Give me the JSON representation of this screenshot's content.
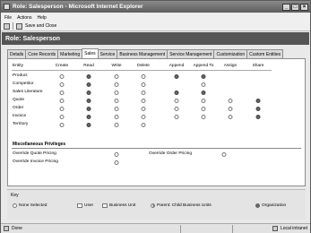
{
  "window": {
    "title": "Role: Salesperson - Microsoft Internet Explorer"
  },
  "menu": [
    "File",
    "Actions",
    "Help"
  ],
  "toolbar": {
    "save_close": "Save and Close"
  },
  "role_header": "Role: Salesperson",
  "tabs": [
    "Details",
    "Core Records",
    "Marketing",
    "Sales",
    "Service",
    "Business Management",
    "Service Management",
    "Customization",
    "Custom Entities"
  ],
  "active_tab": "Sales",
  "grid": {
    "entity_header": "Entity",
    "columns": [
      "Create",
      "Read",
      "Write",
      "Delete",
      "Append",
      "Append To",
      "Assign",
      "Share"
    ],
    "rows": [
      {
        "name": "Product",
        "levels": [
          "none",
          "org",
          "none",
          "none",
          "org",
          "org",
          null,
          null
        ]
      },
      {
        "name": "Competitor",
        "levels": [
          "none",
          "org",
          "none",
          "none",
          null,
          "none",
          null,
          null
        ]
      },
      {
        "name": "Sales Literature",
        "levels": [
          "none",
          "org",
          "none",
          "none",
          "org",
          "org",
          null,
          null
        ]
      },
      {
        "name": "Quote",
        "levels": [
          "none",
          "org",
          "none",
          "none",
          "none",
          "none",
          "none",
          "org"
        ]
      },
      {
        "name": "Order",
        "levels": [
          "none",
          "org",
          "none",
          "none",
          "none",
          "none",
          "none",
          "org"
        ]
      },
      {
        "name": "Invoice",
        "levels": [
          "none",
          "org",
          "none",
          "none",
          "none",
          "none",
          "none",
          "org"
        ]
      },
      {
        "name": "Territory",
        "levels": [
          "none",
          "org",
          "none",
          "none",
          null,
          null,
          null,
          null
        ]
      }
    ]
  },
  "misc": {
    "title": "Miscellaneous Privileges",
    "items": [
      "Override Quote Pricing",
      "Override Order Pricing",
      "Override Invoice Pricing"
    ]
  },
  "key": {
    "title": "Key",
    "items": [
      "None Selected",
      "User",
      "Business Unit",
      "Parent: Child Business Units",
      "Organization"
    ]
  },
  "status": {
    "left": "Done",
    "right": "Local intranet"
  }
}
